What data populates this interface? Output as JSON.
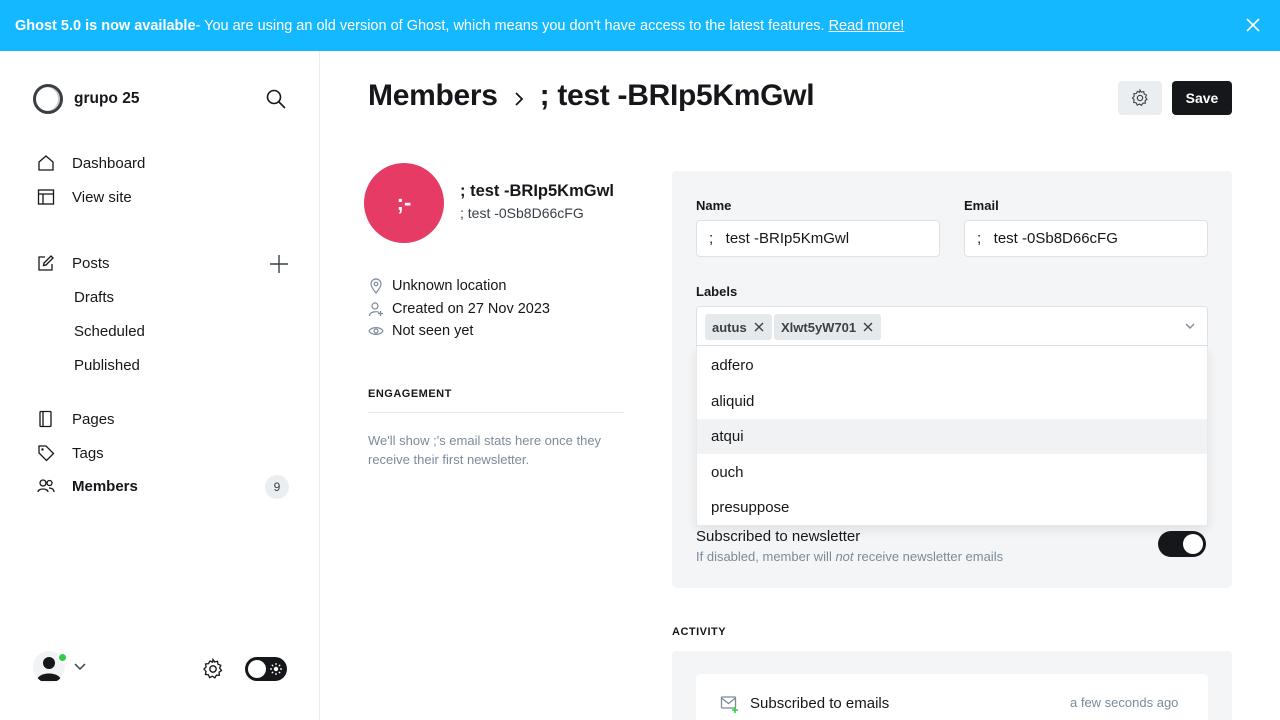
{
  "banner": {
    "bold": "Ghost 5.0 is now available",
    "text": " - You are using an old version of Ghost, which means you don't have access to the latest features.",
    "link": "Read more!"
  },
  "sidebar": {
    "site_name": "grupo 25",
    "items": [
      {
        "label": "Dashboard",
        "icon": "home-icon"
      },
      {
        "label": "View site",
        "icon": "layout-icon"
      },
      {
        "label": "Posts",
        "icon": "edit-icon"
      },
      {
        "label": "Pages",
        "icon": "page-icon"
      },
      {
        "label": "Tags",
        "icon": "tag-icon"
      },
      {
        "label": "Members",
        "icon": "members-icon",
        "count": "9"
      }
    ],
    "post_subitems": [
      "Drafts",
      "Scheduled",
      "Published"
    ]
  },
  "header": {
    "section": "Members",
    "member": "; test -BRIp5KmGwl",
    "save_label": "Save"
  },
  "member": {
    "initials": ";-",
    "name": "; test -BRIp5KmGwl",
    "email": "; test -0Sb8D66cFG",
    "location": "Unknown location",
    "created": "Created on 27 Nov 2023",
    "seen": "Not seen yet"
  },
  "engagement": {
    "title": "ENGAGEMENT",
    "text": "We'll show ;'s email stats here once they receive their first newsletter."
  },
  "form": {
    "name_label": "Name",
    "name_value": ";   test -BRIp5KmGwl",
    "email_label": "Email",
    "email_value": ";   test -0Sb8D66cFG",
    "labels_label": "Labels",
    "chips": [
      "autus",
      "Xlwt5yW701"
    ],
    "options": [
      "adfero",
      "aliquid",
      "atqui",
      "ouch",
      "presuppose"
    ],
    "highlighted_option": "atqui",
    "newsletter_title": "Subscribed to newsletter",
    "newsletter_desc_pre": "If disabled, member will ",
    "newsletter_desc_em": "not",
    "newsletter_desc_post": " receive newsletter emails",
    "newsletter_enabled": true
  },
  "activity": {
    "title": "ACTIVITY",
    "event": "Subscribed to emails",
    "time": "a few seconds ago"
  },
  "colors": {
    "banner": "#14b8ff",
    "avatar": "#e53b65",
    "online": "#30cf43",
    "primary": "#15171a"
  }
}
